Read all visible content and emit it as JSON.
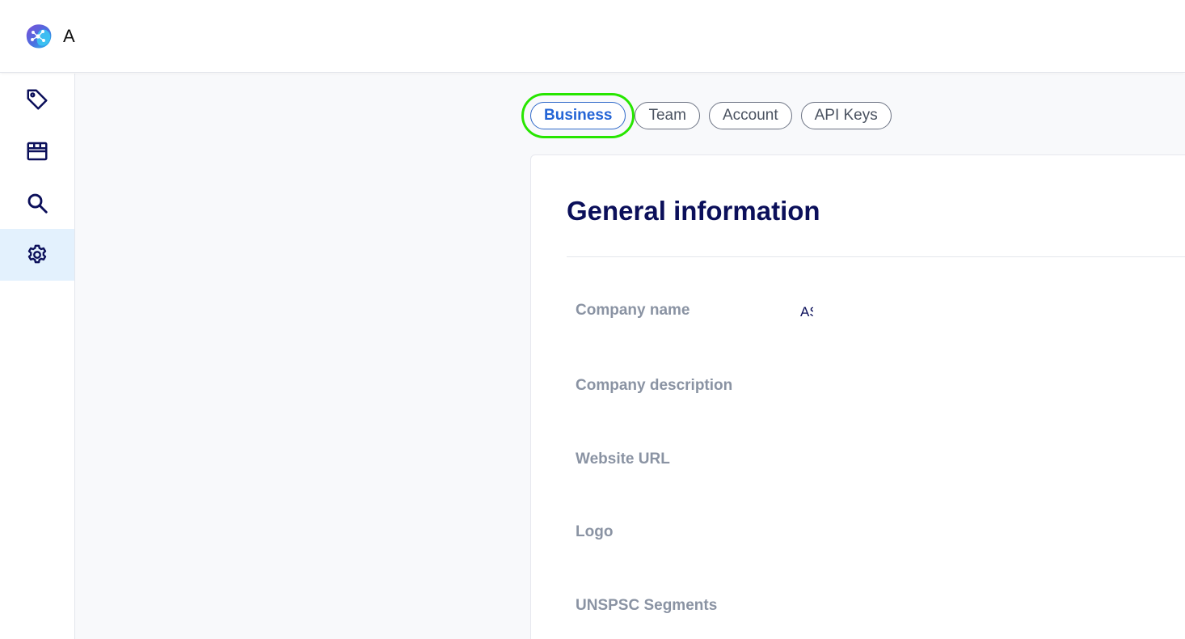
{
  "header": {
    "app_title": "A",
    "logo_icon": "blob-network-logo"
  },
  "sidebar": {
    "items": [
      {
        "name": "tag",
        "icon": "tag-icon",
        "active": false
      },
      {
        "name": "store",
        "icon": "store-icon",
        "active": false
      },
      {
        "name": "search",
        "icon": "search-icon",
        "active": false
      },
      {
        "name": "settings",
        "icon": "gear-icon",
        "active": true
      }
    ]
  },
  "tabs": [
    {
      "label": "Business",
      "active": true
    },
    {
      "label": "Team",
      "active": false
    },
    {
      "label": "Account",
      "active": false
    },
    {
      "label": "API Keys",
      "active": false
    }
  ],
  "general": {
    "title": "General information",
    "fields": [
      {
        "label": "Company name",
        "value": "AS"
      },
      {
        "label": "Company description",
        "value": ""
      },
      {
        "label": "Website URL",
        "value": ""
      },
      {
        "label": "Logo",
        "value": ""
      },
      {
        "label": "UNSPSC Segments",
        "value": ""
      }
    ]
  },
  "colors": {
    "accent": "#2465d6",
    "navy": "#0b0f5a",
    "label_gray": "#8a93a3",
    "active_nav_bg": "#e3f1fd",
    "highlight": "#27e600"
  }
}
